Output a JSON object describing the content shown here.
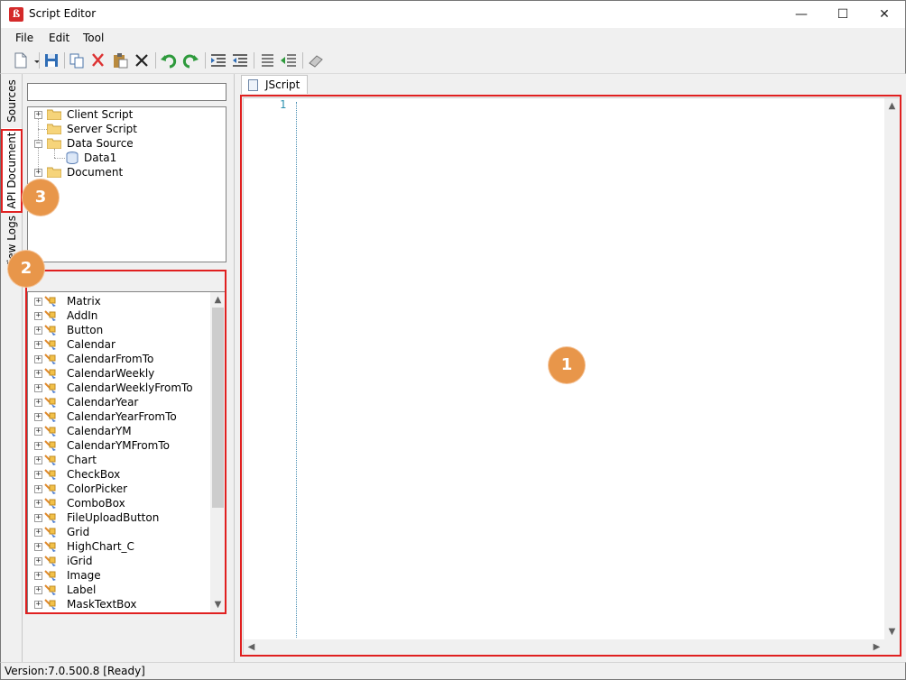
{
  "window": {
    "title": "Script Editor"
  },
  "menu": [
    "File",
    "Edit",
    "Tool"
  ],
  "toolbar": {
    "icons": [
      "new-file-icon",
      "save-icon",
      "copy-icon",
      "cut-icon",
      "paste-icon",
      "delete-icon",
      "undo-icon",
      "redo-icon",
      "indent-icon",
      "outdent-icon",
      "comment-icon",
      "uncomment-icon",
      "eraser-icon"
    ]
  },
  "vertical_tabs": [
    "Sources",
    "API Document",
    "View Logs"
  ],
  "source_tree": {
    "search_value": "",
    "nodes": [
      "Client Script",
      "Server Script",
      "Data Source",
      "Data1",
      "Document"
    ]
  },
  "api_list": {
    "filter_value": "",
    "items": [
      "Matrix",
      "AddIn",
      "Button",
      "Calendar",
      "CalendarFromTo",
      "CalendarWeekly",
      "CalendarWeeklyFromTo",
      "CalendarYear",
      "CalendarYearFromTo",
      "CalendarYM",
      "CalendarYMFromTo",
      "Chart",
      "CheckBox",
      "ColorPicker",
      "ComboBox",
      "FileUploadButton",
      "Grid",
      "HighChart_C",
      "iGrid",
      "Image",
      "Label",
      "MaskTextBox"
    ]
  },
  "editor": {
    "tab_label": "JScript",
    "line_numbers": [
      "1"
    ]
  },
  "annotations": {
    "badge1": "1",
    "badge2": "2",
    "badge3": "3"
  },
  "status": {
    "text": "Version:7.0.500.8  [Ready]"
  },
  "colors": {
    "annotation_red": "#e02020",
    "badge_orange": "#e8964a",
    "line_number_blue": "#2b91af"
  }
}
